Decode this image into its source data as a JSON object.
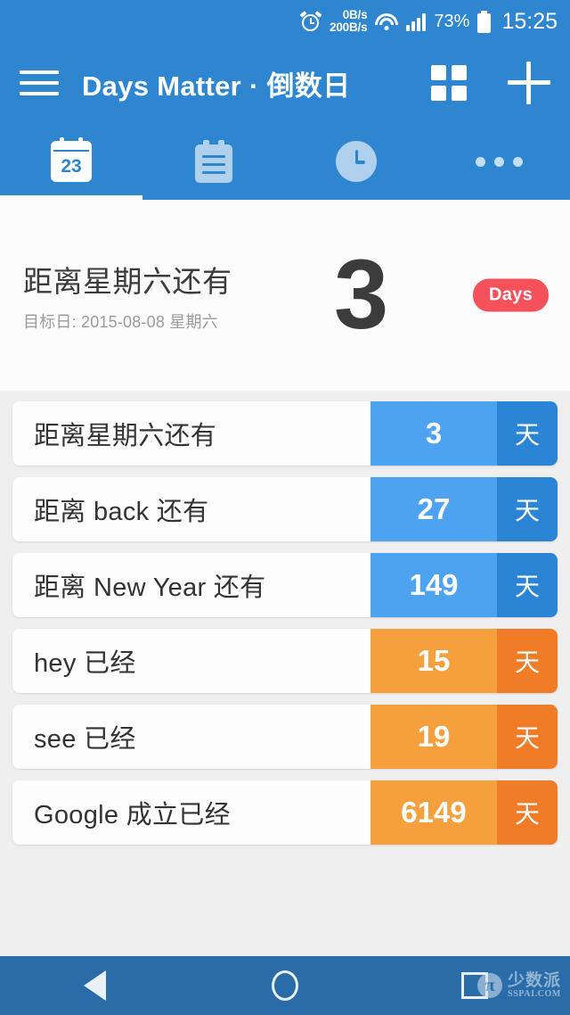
{
  "status_bar": {
    "alarm_icon": "alarm-clock-icon",
    "net_up": "0B/s",
    "net_down": "200B/s",
    "wifi_icon": "wifi-icon",
    "signal_icon": "cellular-signal-icon",
    "battery_percent": "73%",
    "battery_icon": "battery-icon",
    "time": "15:25"
  },
  "app_bar": {
    "menu_icon": "hamburger-menu-icon",
    "title": "Days Matter · 倒数日",
    "grid_icon": "grid-view-icon",
    "add_icon": "plus-icon"
  },
  "tabs": [
    {
      "name": "calendar",
      "icon": "calendar-icon",
      "day_number": "23",
      "active": true
    },
    {
      "name": "list",
      "icon": "notepad-icon",
      "active": false
    },
    {
      "name": "clock",
      "icon": "clock-icon",
      "active": false
    },
    {
      "name": "more",
      "icon": "more-dots-icon",
      "active": false
    }
  ],
  "feature": {
    "title": "距离星期六还有",
    "subtitle": "目标日: 2015-08-08 星期六",
    "count": "3",
    "badge": "Days"
  },
  "list": {
    "unit": "天",
    "items": [
      {
        "label": "距离星期六还有",
        "value": "3",
        "unit": "天",
        "kind": "blue"
      },
      {
        "label": "距离 back 还有",
        "value": "27",
        "unit": "天",
        "kind": "blue"
      },
      {
        "label": "距离 New Year 还有",
        "value": "149",
        "unit": "天",
        "kind": "blue"
      },
      {
        "label": "hey 已经",
        "value": "15",
        "unit": "天",
        "kind": "orange"
      },
      {
        "label": "see 已经",
        "value": "19",
        "unit": "天",
        "kind": "orange"
      },
      {
        "label": "Google 成立已经",
        "value": "6149",
        "unit": "天",
        "kind": "orange"
      }
    ]
  },
  "nav_bar": {
    "back_icon": "back-triangle-icon",
    "home_icon": "home-circle-icon",
    "recents_icon": "recents-square-icon"
  },
  "watermark": {
    "logo": "pi-logo-icon",
    "logo_glyph": "π",
    "cn": "少数派",
    "en": "SSPAI.COM"
  },
  "colors": {
    "primary_blue": "#2E86D0",
    "nav_blue": "#2A6CA8",
    "row_blue_light": "#4DA3EF",
    "row_blue_dark": "#2B85D4",
    "row_orange_light": "#F5A03C",
    "row_orange_dark": "#F07C27",
    "badge_red": "#F4515B",
    "list_bg": "#EFEFEF"
  }
}
